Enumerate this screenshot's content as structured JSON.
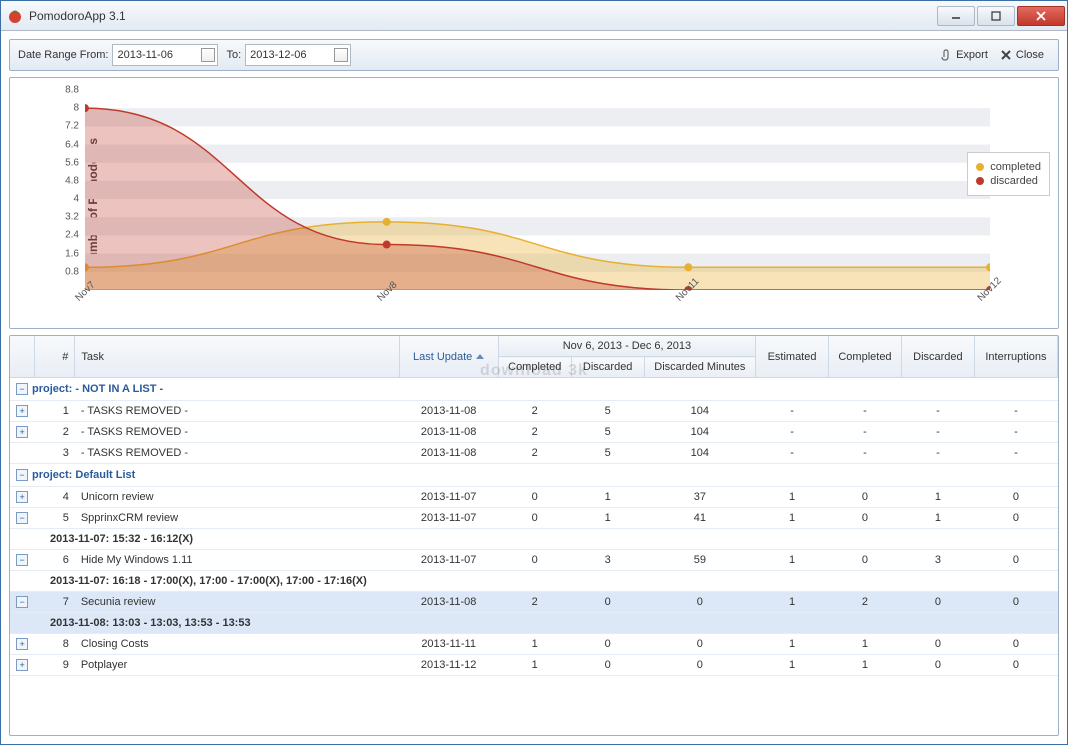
{
  "window": {
    "title": "PomodoroApp 3.1"
  },
  "toolbar": {
    "date_from_label": "Date Range From:",
    "date_from": "2013-11-06",
    "date_to_label": "To:",
    "date_to": "2013-12-06",
    "export_label": "Export",
    "close_label": "Close"
  },
  "chart_data": {
    "type": "area",
    "title": "",
    "ylabel": "Number of Pomodoros",
    "xlabel": "",
    "categories": [
      "Nov7",
      "Nov8",
      "Nov11",
      "Nov12"
    ],
    "yticks": [
      0.8,
      1.6,
      2.4,
      3.2,
      4,
      4.8,
      5.6,
      6.4,
      7.2,
      8,
      8.8
    ],
    "ylim": [
      0,
      8.8
    ],
    "series": [
      {
        "name": "completed",
        "color": "#e8b030",
        "fill": "rgba(232,176,48,0.35)",
        "values": [
          1,
          3,
          1,
          1
        ]
      },
      {
        "name": "discarded",
        "color": "#c0392b",
        "fill": "rgba(192,57,43,0.30)",
        "values": [
          8,
          2,
          0,
          0
        ]
      }
    ],
    "legend": {
      "position": "right"
    }
  },
  "table": {
    "headers": {
      "num": "#",
      "task": "Task",
      "last_update": "Last Update",
      "date_range": "Nov 6, 2013 - Dec 6, 2013",
      "range_completed": "Completed",
      "range_discarded": "Discarded",
      "range_discarded_min": "Discarded Minutes",
      "estimated": "Estimated",
      "completed": "Completed",
      "discarded": "Discarded",
      "interruptions": "Interruptions"
    },
    "groups": [
      {
        "label": "project: - NOT IN A LIST -",
        "rows": [
          {
            "exp": "+",
            "num": 1,
            "task": "- TASKS REMOVED -",
            "last": "2013-11-08",
            "rc": 2,
            "rd": 5,
            "rm": 104,
            "est": "-",
            "c": "-",
            "d": "-",
            "i": "-"
          },
          {
            "exp": "+",
            "num": 2,
            "task": "- TASKS REMOVED -",
            "last": "2013-11-08",
            "rc": 2,
            "rd": 5,
            "rm": 104,
            "est": "-",
            "c": "-",
            "d": "-",
            "i": "-"
          },
          {
            "exp": "",
            "num": 3,
            "task": "- TASKS REMOVED -",
            "last": "2013-11-08",
            "rc": 2,
            "rd": 5,
            "rm": 104,
            "est": "-",
            "c": "-",
            "d": "-",
            "i": "-"
          }
        ]
      },
      {
        "label": "project: Default List",
        "rows": [
          {
            "exp": "+",
            "num": 4,
            "task": "Unicorn review",
            "last": "2013-11-07",
            "rc": 0,
            "rd": 1,
            "rm": 37,
            "est": 1,
            "c": 0,
            "d": 1,
            "i": 0
          },
          {
            "exp": "-",
            "num": 5,
            "task": "SpprinxCRM review",
            "last": "2013-11-07",
            "rc": 0,
            "rd": 1,
            "rm": 41,
            "est": 1,
            "c": 0,
            "d": 1,
            "i": 0,
            "detail": "2013-11-07: 15:32 - 16:12(X)"
          },
          {
            "exp": "-",
            "num": 6,
            "task": "Hide My Windows 1.11",
            "last": "2013-11-07",
            "rc": 0,
            "rd": 3,
            "rm": 59,
            "est": 1,
            "c": 0,
            "d": 3,
            "i": 0,
            "detail": "2013-11-07: 16:18 - 17:00(X), 17:00 - 17:00(X), 17:00 - 17:16(X)"
          },
          {
            "exp": "-",
            "num": 7,
            "task": "Secunia review",
            "last": "2013-11-08",
            "rc": 2,
            "rd": 0,
            "rm": 0,
            "est": 1,
            "c": 2,
            "d": 0,
            "i": 0,
            "selected": true,
            "detail": "2013-11-08: 13:03 - 13:03, 13:53 - 13:53"
          },
          {
            "exp": "+",
            "num": 8,
            "task": "Closing Costs",
            "last": "2013-11-11",
            "rc": 1,
            "rd": 0,
            "rm": 0,
            "est": 1,
            "c": 1,
            "d": 0,
            "i": 0
          },
          {
            "exp": "+",
            "num": 9,
            "task": "Potplayer",
            "last": "2013-11-12",
            "rc": 1,
            "rd": 0,
            "rm": 0,
            "est": 1,
            "c": 1,
            "d": 0,
            "i": 0
          }
        ]
      }
    ]
  },
  "watermark": "download 3k"
}
